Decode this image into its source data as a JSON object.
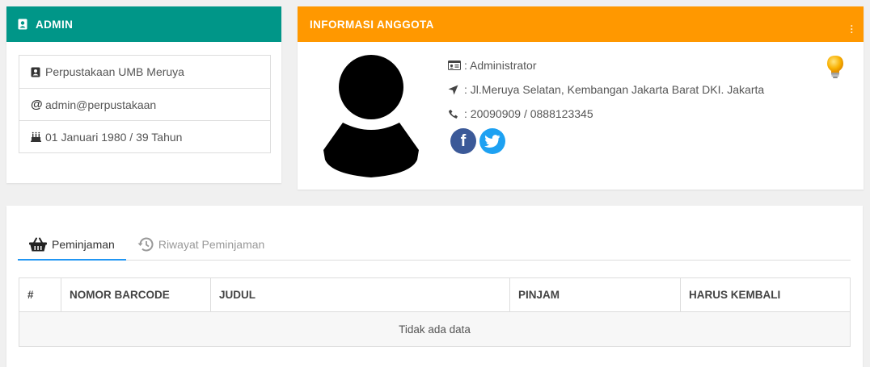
{
  "admin_card": {
    "title": "ADMIN",
    "items": [
      {
        "icon": "address-card-icon",
        "text": "Perpustakaan UMB Meruya"
      },
      {
        "icon": "at-icon",
        "text": "admin@perpustakaan"
      },
      {
        "icon": "birthday-cake-icon",
        "text": "01 Januari 1980 / 39 Tahun"
      }
    ]
  },
  "member_card": {
    "title": "INFORMASI ANGGOTA",
    "role": ": Administrator",
    "address": ": Jl.Meruya Selatan, Kembangan Jakarta Barat DKI. Jakarta",
    "phone": ": 20090909 / 0888123345",
    "facebook_label": "f"
  },
  "tabs": {
    "active": "Peminjaman",
    "history": "Riwayat Peminjaman"
  },
  "table": {
    "columns": [
      "#",
      "NOMOR BARCODE",
      "JUDUL",
      "PINJAM",
      "HARUS KEMBALI"
    ],
    "empty_text": "Tidak ada data"
  },
  "colors": {
    "admin_header": "#009688",
    "member_header": "#ff9800",
    "facebook": "#3b5998",
    "twitter": "#1da1f2",
    "tab_active_underline": "#2196f3"
  }
}
